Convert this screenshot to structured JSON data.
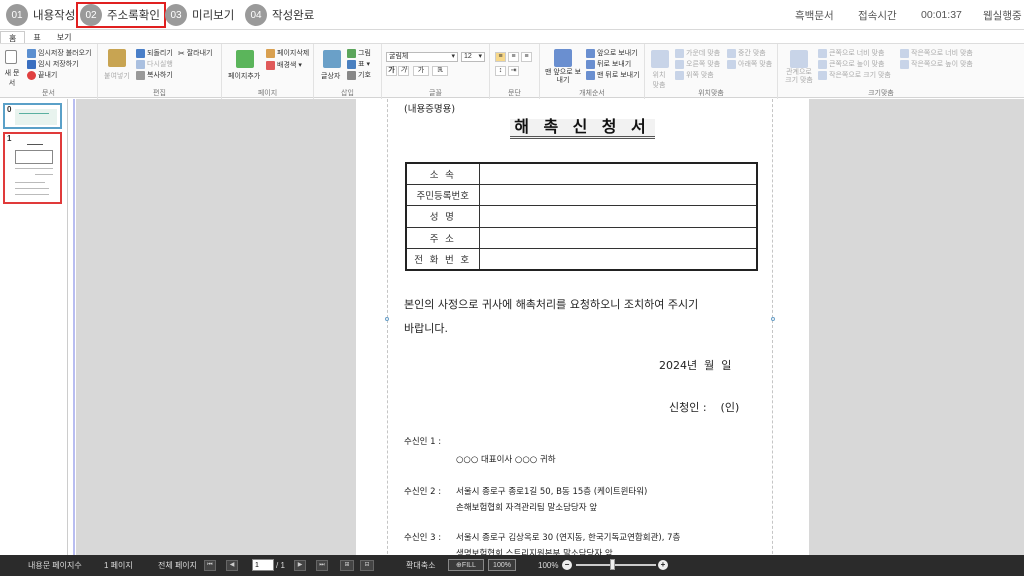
{
  "steps": [
    {
      "num": "01",
      "label": "내용작성"
    },
    {
      "num": "02",
      "label": "주소록확인"
    },
    {
      "num": "03",
      "label": "미리보기"
    },
    {
      "num": "04",
      "label": "작성완료"
    }
  ],
  "top_info": {
    "doc_type": "흑백문서",
    "time_label": "접속시간",
    "time_value": "00:01:37",
    "status": "웹실행중"
  },
  "tabs": [
    "홈",
    "표",
    "보기"
  ],
  "ribbon": {
    "doc": {
      "new": "새 문서",
      "load_temp": "임시저장 불러오기",
      "save_temp": "임시 저장하기",
      "close": "끝내기",
      "group": "문서"
    },
    "edit": {
      "paste": "붙여넣기",
      "undo": "되돌리기",
      "redo": "다시실행",
      "cut": "잘라내기",
      "copy": "복사하기",
      "group": "편집"
    },
    "page": {
      "add": "페이지추가",
      "delete": "페이지삭제",
      "bg": "배경색",
      "group": "페이지"
    },
    "insert": {
      "textbox": "글상자",
      "image": "그림",
      "table": "표",
      "symbol": "기호",
      "group": "삽입"
    },
    "font": {
      "family": "굴림체",
      "size": "12",
      "bold": "가",
      "italic": "가",
      "more": "가",
      "group": "글꼴"
    },
    "para": {
      "group": "문단"
    },
    "object": {
      "front": "맨 앞으로 보내기",
      "forward": "앞으로 보내기",
      "backward": "뒤로 보내기",
      "back": "맨 뒤로 보내기",
      "group": "개체순서"
    },
    "align": {
      "fit": "위치 맞춤",
      "center": "가운데 맞춤",
      "middle": "중간 맞춤",
      "right": "오른쪽 맞춤",
      "bottom": "아래쪽 맞춤",
      "top": "위쪽 맞춤",
      "group": "위치맞춤"
    },
    "size": {
      "fit": "관계으로 크기 맞춤",
      "w_big": "큰쪽으로 너비 맞춤",
      "h_big": "큰쪽으로 높이 맞춤",
      "s_big": "작은쪽으로 크기 맞춤",
      "w_small": "작은쪽으로 너비 맞춤",
      "h_small": "작은쪽으로 높이 맞춤",
      "group": "크기맞춤"
    }
  },
  "thumbnails": [
    "0",
    "1"
  ],
  "document": {
    "header": "(내용증명용)",
    "title": "해 촉 신 청 서",
    "rows": [
      "소 속",
      "주민등록번호",
      "성 명",
      "주 소",
      "전 화 번 호"
    ],
    "body": "본인의 사정으로 귀사에 해촉처리를 요청하오니 조치하여 주시기",
    "body2": "바랍니다.",
    "date": "2024년  월  일",
    "signer": "신청인 :    (인)",
    "r1_label": "수신인 1 :",
    "r1_line": "○○○ 대표이사 ○○○ 귀하",
    "r2_label": "수신인 2 :",
    "r2_line1": "서울시 종로구 종로1길 50, B동 15층 (케이트윈타워)",
    "r2_line2": "손해보험협회 자격관리팀 말소담당자 앞",
    "r3_label": "수신인 3 :",
    "r3_line1": "서울시 종로구 김상옥로 30 (연지동, 한국기독교연합회관), 7층",
    "r3_line2": "생명보험협회 스트리지원본부 말소담당자 앞"
  },
  "status": {
    "page_count_label": "내용문 페이지수",
    "page_count": "1 페이지",
    "total_label": "전체 페이지",
    "current_page": "1",
    "total_pages": "/ 1",
    "zoom_label": "확대축소",
    "fill": "FILL",
    "pct_btn": "100%",
    "zoom": "100%"
  }
}
